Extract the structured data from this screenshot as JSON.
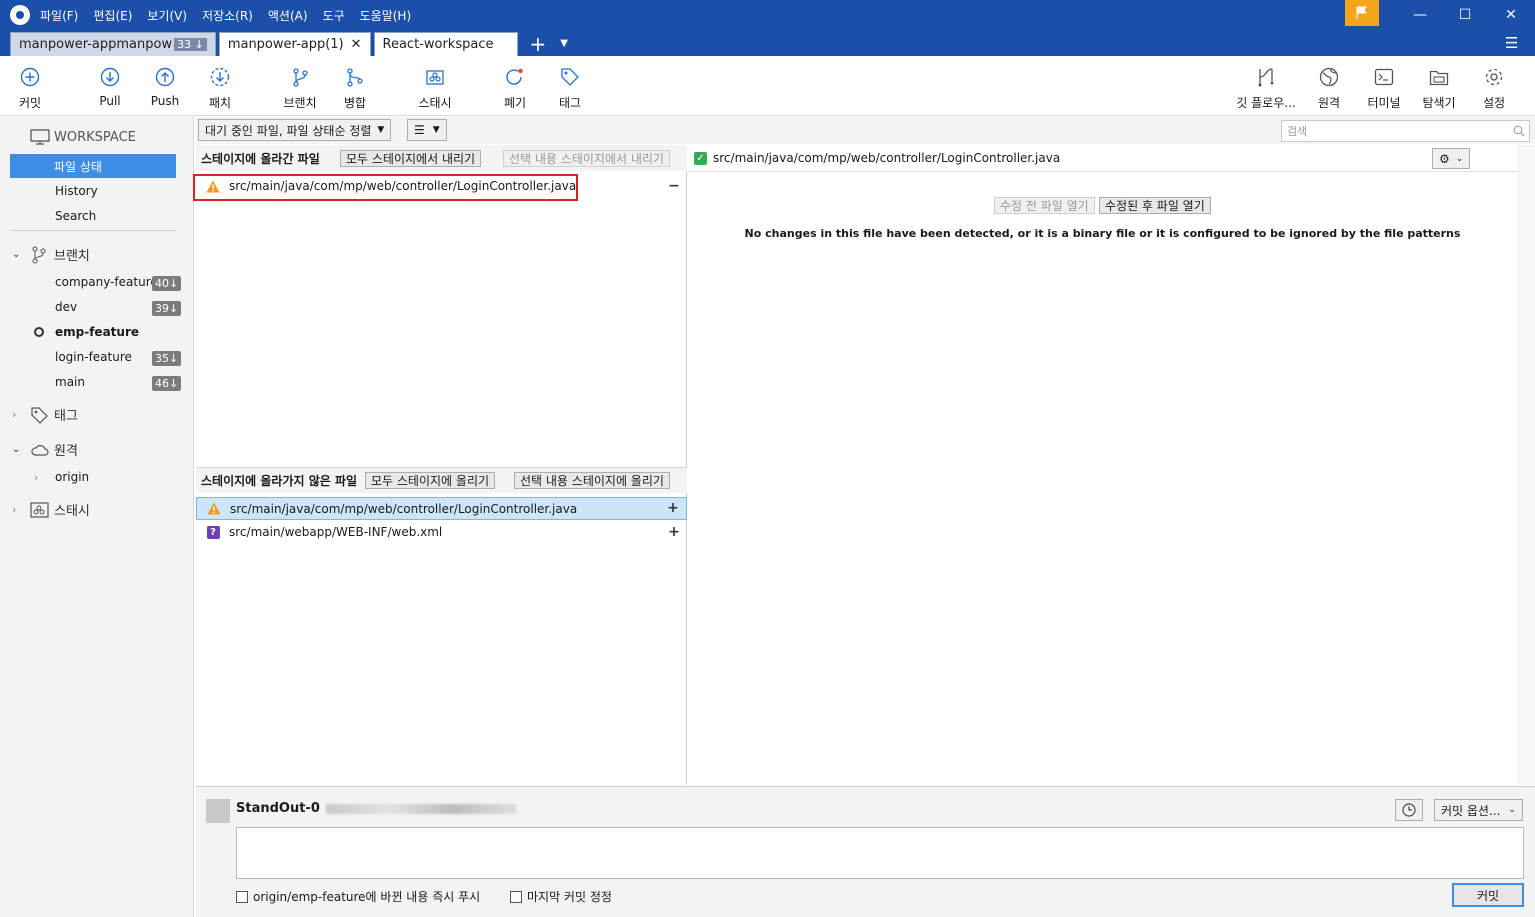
{
  "menu": [
    "파일(F)",
    "편집(E)",
    "보기(V)",
    "저장소(R)",
    "액션(A)",
    "도구",
    "도움말(H)"
  ],
  "tabs": [
    {
      "label": "manpower-appmanpow",
      "badge": "33 ↓"
    },
    {
      "label": "manpower-app(1)",
      "close": "✕"
    },
    {
      "label": "React-workspace"
    }
  ],
  "toolbar": {
    "commit": "커밋",
    "pull": "Pull",
    "push": "Push",
    "fetch": "패치",
    "branch": "브랜치",
    "merge": "병합",
    "stash": "스태시",
    "discard": "폐기",
    "tag": "태그",
    "gitflow": "깃 플로우...",
    "remote": "원격",
    "terminal": "터미널",
    "explorer": "탐색기",
    "settings": "설정"
  },
  "sidebar": {
    "workspace": "WORKSPACE",
    "file_status": "파일 상태",
    "history": "History",
    "search": "Search",
    "branches_label": "브랜치",
    "branches": [
      {
        "name": "company-feature",
        "count": "40↓"
      },
      {
        "name": "dev",
        "count": "39↓"
      },
      {
        "name": "emp-feature",
        "current": true
      },
      {
        "name": "login-feature",
        "count": "35↓"
      },
      {
        "name": "main",
        "count": "46↓"
      }
    ],
    "tags_label": "태그",
    "remotes_label": "원격",
    "remote_origin": "origin",
    "stash_label": "스태시"
  },
  "filter": {
    "sort": "대기 중인 파일, 파일 상태순 정렬",
    "view": "☰",
    "search_placeholder": "검색"
  },
  "staged": {
    "title": "스테이지에 올라간 파일",
    "unstage_all": "모두 스테이지에서 내리기",
    "unstage_selected": "선택 내용 스테이지에서 내리기",
    "files": [
      {
        "path": "src/main/java/com/mp/web/controller/LoginController.java",
        "status": "warning"
      }
    ]
  },
  "unstaged": {
    "title": "스테이지에 올라가지 않은 파일",
    "stage_all": "모두 스테이지에 올리기",
    "stage_selected": "선택 내용 스테이지에 올리기",
    "files": [
      {
        "path": "src/main/java/com/mp/web/controller/LoginController.java",
        "status": "warning"
      },
      {
        "path": "src/main/webapp/WEB-INF/web.xml",
        "status": "unknown"
      }
    ]
  },
  "diff": {
    "file": "src/main/java/com/mp/web/controller/LoginController.java",
    "open_before": "수정 전 파일 열기",
    "open_after": "수정된 후 파일 열기",
    "message": "No changes in this file have been detected, or it is a binary file or it is configured to be ignored by the file patterns"
  },
  "commit": {
    "author": "StandOut-0",
    "options": "커밋 옵션...",
    "push_now": "origin/emp-feature에 바뀐 내용 즉시 푸시",
    "amend": "마지막 커밋 정정",
    "button": "커밋"
  },
  "colors": {
    "titlebar": "#1c4fa8",
    "accent": "#3d8ee6",
    "highlight": "#e02020",
    "warning": "#f29a1d",
    "unknown": "#6b3fb5"
  }
}
